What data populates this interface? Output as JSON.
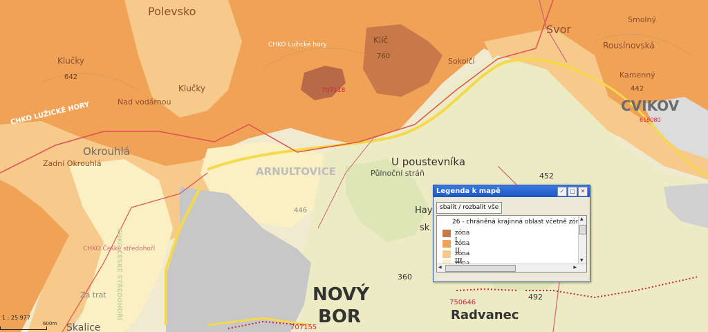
{
  "map": {
    "places": {
      "polevsko": "Polevsko",
      "svor": "Svor",
      "chko_luzicke": "CHKO Lužické hory",
      "klic": "Klíč",
      "klic_elev": "760",
      "klucky_upper": "Klučky",
      "klucky_elev": "642",
      "klucky_lower": "Klučky",
      "nad_vodarnou": "Nad vodárnou",
      "chko_band": "CHKO LUŽICKÉ HORY",
      "sokolcan": "Sokolčí",
      "arnultovice": "ARNULTOVICE",
      "okrouhla": "Okrouhlá",
      "zadni_okrouhla": "Zadní Okrouhlá",
      "u_poustevnika": "U poustevníka",
      "pulnocni_stran": "Půlnoční stráň",
      "elev_452": "452",
      "elev_446": "446",
      "elev_360": "360",
      "elev_492": "492",
      "rousinovska": "Rousínovská",
      "kamenny": "Kamenný",
      "kamenny_elev": "442",
      "cvikov": "CVIKOV",
      "smolny": "Smolný",
      "chko_ceske": "CHKO České středohoří",
      "chko_ceske_rotated": "CHKO ČESKÉ STŘEDOHOŘÍ",
      "novy": "NOVÝ",
      "bor": "BOR",
      "radvanec": "Radvanec",
      "code_750646": "750646",
      "code_707155": "707155",
      "code_618080": "618080",
      "code_707118": "707118",
      "skalice": "Skalice",
      "za_tratí": "Za trat",
      "hay": "Hay",
      "sk": "sk"
    }
  },
  "legend": {
    "title": "Legenda k mapě",
    "toggle_label": "sbalit / rozbalit vše",
    "heading": "26 - chráněná krajinná oblast včetně zón",
    "items": [
      {
        "label": "zóna I",
        "color": "#c8794a"
      },
      {
        "label": "zóna II",
        "color": "#f0a256"
      },
      {
        "label": "zóna III",
        "color": "#f7c98b"
      },
      {
        "label": "zóna IV",
        "color": "#faf0c4"
      }
    ]
  },
  "scale": {
    "ratio": "1 : 25 977",
    "bar_label": "600m"
  },
  "colors": {
    "zone1": "#c8794a",
    "zone2": "#f0a256",
    "zone3": "#f7c98b",
    "zone4": "#faf0c4",
    "boundary": "#e05050",
    "road": "#f5d94a"
  }
}
